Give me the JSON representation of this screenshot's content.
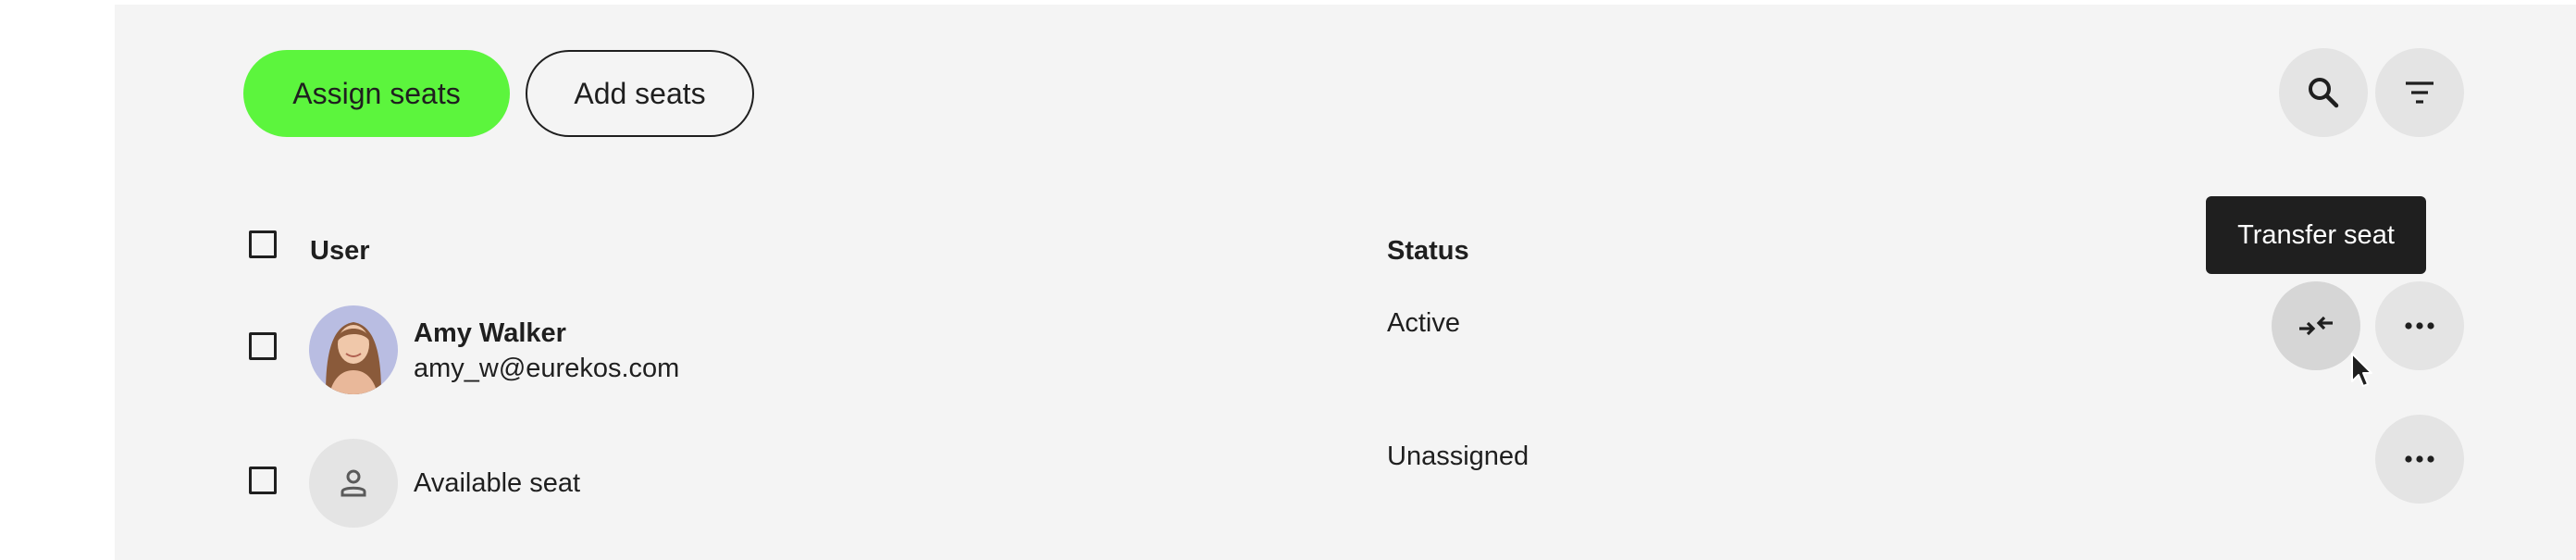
{
  "toolbar": {
    "assign_label": "Assign seats",
    "add_label": "Add seats",
    "assign_color": "#5cf53d"
  },
  "table": {
    "columns": [
      "User",
      "Status"
    ],
    "rows": [
      {
        "name": "Amy Walker",
        "email": "amy_w@eurekos.com",
        "status": "Active",
        "actions": [
          "transfer-icon",
          "more-icon"
        ]
      },
      {
        "name": "Available seat",
        "status": "Unassigned",
        "actions": [
          "more-icon"
        ]
      }
    ]
  },
  "tooltip": {
    "text": "Transfer seat"
  },
  "icons": [
    "search-icon",
    "filter-icon",
    "transfer-icon",
    "more-icon",
    "person-icon"
  ]
}
